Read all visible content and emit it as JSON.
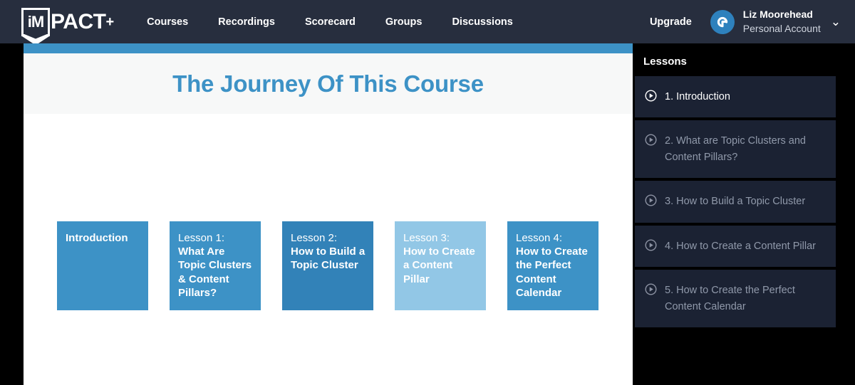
{
  "header": {
    "logo": {
      "badge_text": "iM",
      "word": "PACT",
      "plus": "+",
      "icon": "impact-shield-logo"
    },
    "nav": [
      {
        "label": "Courses"
      },
      {
        "label": "Recordings"
      },
      {
        "label": "Scorecard"
      },
      {
        "label": "Groups"
      },
      {
        "label": "Discussions"
      }
    ],
    "upgrade_label": "Upgrade",
    "account": {
      "name": "Liz Moorehead",
      "subtitle": "Personal Account",
      "avatar_icon": "spiral-avatar-icon",
      "chevron_icon": "chevron-down-icon"
    },
    "background": "#272e3e"
  },
  "main": {
    "accent_bar_color": "#3d92c6",
    "hero_title": "The Journey Of This Course",
    "hero_background": "#f7f8f8",
    "cards": [
      {
        "eyebrow": "",
        "title": "Introduction",
        "color": "#3d92c6"
      },
      {
        "eyebrow": "Lesson 1:",
        "title": "What Are Topic Clusters & Content Pillars?",
        "color": "#3d92c6"
      },
      {
        "eyebrow": "Lesson 2:",
        "title": "How to Build a Topic Cluster",
        "color": "#3282b8"
      },
      {
        "eyebrow": "Lesson 3:",
        "title": "How to Create a Content Pillar",
        "color": "#92c7e6"
      },
      {
        "eyebrow": "Lesson 4:",
        "title": "How to Create the Perfect Content Calendar",
        "color": "#3d92c6"
      }
    ]
  },
  "sidebar": {
    "title": "Lessons",
    "items": [
      {
        "label": "1. Introduction",
        "icon": "play-circle-icon",
        "active": true
      },
      {
        "label": "2. What are Topic Clusters and Content Pillars?",
        "icon": "play-circle-icon",
        "active": false
      },
      {
        "label": "3. How to Build a Topic Cluster",
        "icon": "play-circle-icon",
        "active": false
      },
      {
        "label": "4. How to Create a Content Pillar",
        "icon": "play-circle-icon",
        "active": false
      },
      {
        "label": "5. How to Create the Perfect Content Calendar",
        "icon": "play-circle-icon",
        "active": false
      }
    ]
  }
}
